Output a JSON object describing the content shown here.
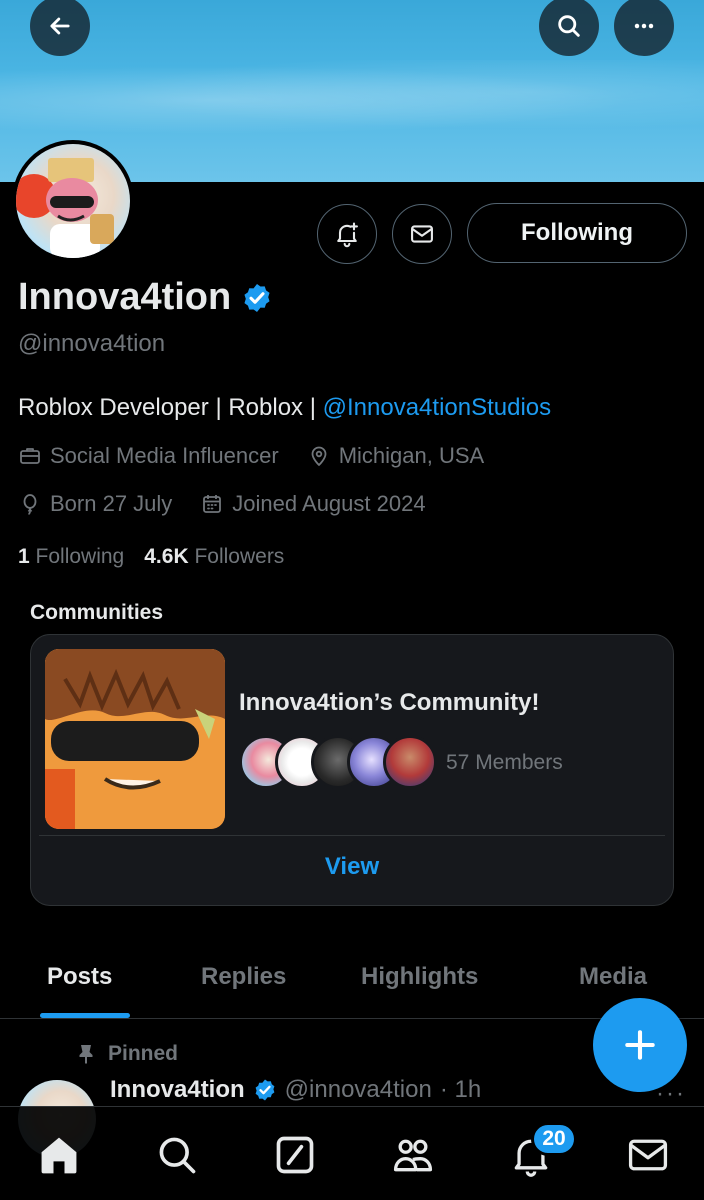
{
  "header": {
    "back_icon": "arrow-left-icon",
    "search_icon": "search-icon",
    "more_icon": "more-horizontal-icon"
  },
  "profile": {
    "name": "Innova4tion",
    "handle": "@innova4tion",
    "verified": true,
    "bio_text": "Roblox Developer | Roblox | ",
    "bio_link": "@Innova4tionStudios",
    "category": "Social Media Influencer",
    "location": "Michigan, USA",
    "birthday": "Born 27 July",
    "joined": "Joined August 2024",
    "following_count": "1",
    "following_label": "Following",
    "followers_count": "4.6K",
    "followers_label": "Followers",
    "follow_button_label": "Following"
  },
  "communities": {
    "section_title": "Communities",
    "name": "Innova4tion’s Community!",
    "members": "57 Members",
    "view_label": "View"
  },
  "tabs": [
    {
      "label": "Posts"
    },
    {
      "label": "Replies"
    },
    {
      "label": "Highlights"
    },
    {
      "label": "Media"
    }
  ],
  "post": {
    "pinned_label": "Pinned",
    "author_name": "Innova4tion",
    "author_handle": "@innova4tion",
    "time": "· 1h",
    "more": "···"
  },
  "nav": {
    "notifications_badge": "20"
  },
  "colors": {
    "accent": "#1d9bf0",
    "background": "#000000",
    "muted": "#71767b"
  }
}
